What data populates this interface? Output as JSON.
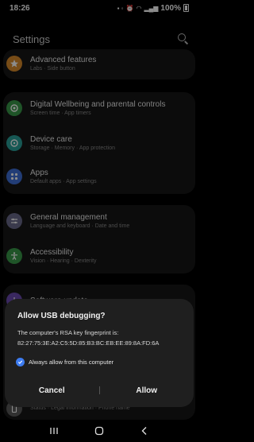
{
  "status_bar": {
    "time": "18:26",
    "battery": "100%"
  },
  "header": {
    "title": "Settings"
  },
  "settings": [
    {
      "title": "Advanced features",
      "subtitle": "Labs  ·  Side button",
      "icon": "star-icon",
      "color": "#d98a2a"
    },
    {
      "title": "Digital Wellbeing and parental controls",
      "subtitle": "Screen time  ·  App timers",
      "icon": "wellbeing-icon",
      "color": "#3a9a4a"
    },
    {
      "title": "Device care",
      "subtitle": "Storage  ·  Memory  ·  App protection",
      "icon": "device-care-icon",
      "color": "#2aa09a"
    },
    {
      "title": "Apps",
      "subtitle": "Default apps  ·  App settings",
      "icon": "apps-icon",
      "color": "#3e6fd8"
    },
    {
      "title": "General management",
      "subtitle": "Language and keyboard  ·  Date and time",
      "icon": "general-management-icon",
      "color": "#6a6a8a"
    },
    {
      "title": "Accessibility",
      "subtitle": "Vision  ·  Hearing  ·  Dexterity",
      "icon": "accessibility-icon",
      "color": "#3a9a4a"
    },
    {
      "title": "Software update",
      "subtitle": "",
      "icon": "software-update-icon",
      "color": "#6a4ab0"
    },
    {
      "title": "",
      "subtitle": "Status  ·  Legal information  ·  Phone name",
      "icon": "about-phone-icon",
      "color": "#5a5a5a"
    }
  ],
  "dialog": {
    "title": "Allow USB debugging?",
    "body_line1": "The computer's RSA key fingerprint is:",
    "fingerprint": "82:27:75:3E:A2:C5:5D:85:B3:BC:EB:EE:89:8A:FD:6A",
    "checkbox_label": "Always allow from this computer",
    "checkbox_checked": true,
    "cancel_label": "Cancel",
    "allow_label": "Allow",
    "accent_color": "#3d7cf0"
  },
  "nav": {
    "recents": "recents-icon",
    "home": "home-icon",
    "back": "back-icon"
  }
}
